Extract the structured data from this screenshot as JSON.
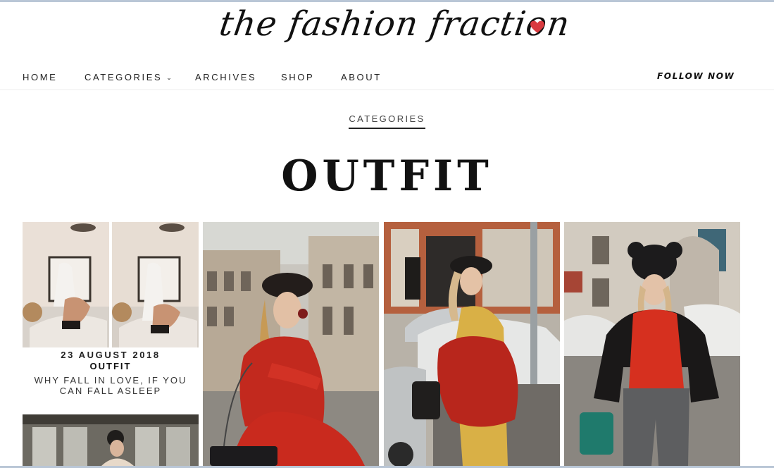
{
  "site": {
    "logo_text": "the fashion fraction",
    "logo_heart_color": "#d93a3f"
  },
  "nav": {
    "items": [
      {
        "label": "HOME"
      },
      {
        "label": "CATEGORIES",
        "has_dropdown": true
      },
      {
        "label": "ARCHIVES"
      },
      {
        "label": "SHOP"
      },
      {
        "label": "ABOUT"
      }
    ],
    "follow_label": "FOLLOW NOW"
  },
  "breadcrumb": {
    "label": "CATEGORIES"
  },
  "page": {
    "title": "OUTFIT"
  },
  "posts": [
    {
      "date": "23 AUGUST 2018",
      "category": "OUTFIT",
      "title": "WHY FALL IN LOVE, IF YOU CAN FALL ASLEEP",
      "image": "bedroom-diptych"
    },
    {
      "image": "red-dress-paris-street"
    },
    {
      "image": "red-fur-jacket-street"
    },
    {
      "image": "black-leather-jacket-street"
    },
    {
      "image": "cafe-portrait"
    }
  ],
  "colors": {
    "accent_underline": "#222222",
    "frame_line": "#b9c6d6"
  }
}
